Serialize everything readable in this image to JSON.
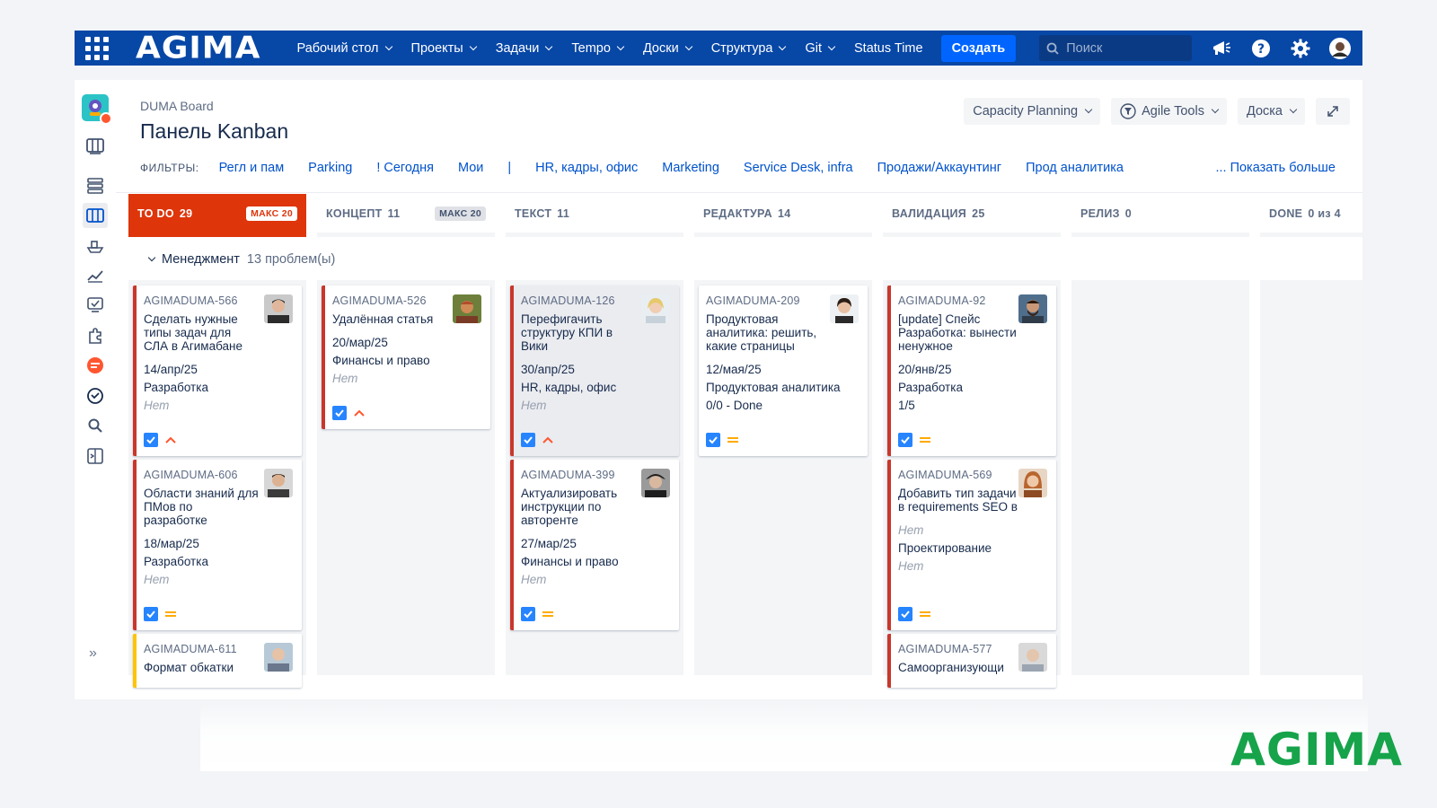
{
  "topbar": {
    "logo": "AGIMA",
    "nav": [
      "Рабочий стол",
      "Проекты",
      "Задачи",
      "Tempo",
      "Доски",
      "Структура",
      "Git"
    ],
    "status_time": "Status Time",
    "create_label": "Создать",
    "search_placeholder": "Поиск",
    "accent": "#0747a6"
  },
  "sidebar": {
    "icons": [
      "board-icon",
      "backlog-icon",
      "kanban-icon",
      "releases-icon",
      "reports-icon",
      "pages-icon",
      "addons-icon",
      "timer-app-icon",
      "clock-icon",
      "search-icon",
      "shortcut-icon"
    ],
    "expand": "»"
  },
  "header": {
    "breadcrumb": "DUMA Board",
    "title": "Панель Kanban",
    "buttons": [
      "Capacity Planning",
      "Agile Tools",
      "Доска"
    ]
  },
  "filters": {
    "label": "ФИЛЬТРЫ:",
    "items": [
      "Регл и пам",
      "Parking",
      "! Сегодня",
      "Мои",
      "|",
      "HR, кадры, офис",
      "Marketing",
      "Service Desk, infra",
      "Продажи/Аккаунтинг",
      "Прод аналитика"
    ],
    "show_more": "... Показать больше"
  },
  "columns": [
    {
      "name": "TO DO",
      "count": "29",
      "max": "МАКС 20",
      "over_limit": true
    },
    {
      "name": "КОНЦЕПТ",
      "count": "11",
      "max": "МАКС 20",
      "over_limit": false
    },
    {
      "name": "ТЕКСТ",
      "count": "11",
      "max": "",
      "over_limit": false
    },
    {
      "name": "РЕДАКТУРА",
      "count": "14",
      "max": "",
      "over_limit": false
    },
    {
      "name": "ВАЛИДАЦИЯ",
      "count": "25",
      "max": "",
      "over_limit": false
    },
    {
      "name": "РЕЛИЗ",
      "count": "0",
      "max": "",
      "over_limit": false
    },
    {
      "name": "DONE",
      "count": "0 из 4",
      "max": "",
      "over_limit": false
    }
  ],
  "swimlane": {
    "name": "Менеджмент",
    "count": "13 проблем(ы)"
  },
  "cards": [
    {
      "key": "AGIMADUMA-566",
      "summary": "Сделать нужные типы задач для СЛА в Агимабане",
      "date": "14/апр/25",
      "field1": "Разработка",
      "field2": "Нет",
      "priority": "high"
    },
    {
      "key": "AGIMADUMA-606",
      "summary": "Области знаний для ПМов по разработке",
      "date": "18/мар/25",
      "field1": "Разработка",
      "field2": "Нет",
      "priority": "medium"
    },
    {
      "key": "AGIMADUMA-611",
      "summary": "Формат обкатки",
      "priority": "none"
    },
    {
      "key": "AGIMADUMA-526",
      "summary": "Удалённая статья",
      "date": "20/мар/25",
      "field1": "Финансы и право",
      "field2": "Нет",
      "priority": "high"
    },
    {
      "key": "AGIMADUMA-126",
      "summary": "Перефигачить структуру КПИ в Вики",
      "date": "30/апр/25",
      "field1": "HR, кадры, офис",
      "field2": "Нет",
      "priority": "high"
    },
    {
      "key": "AGIMADUMA-399",
      "summary": "Актуализировать инструкции по авторенте",
      "date": "27/мар/25",
      "field1": "Финансы и право",
      "field2": "Нет",
      "priority": "medium"
    },
    {
      "key": "AGIMADUMA-209",
      "summary": "Продуктовая аналитика: решить, какие страницы",
      "date": "12/мая/25",
      "field1": "Продуктовая аналитика",
      "field2": "0/0 - Done",
      "priority": "medium"
    },
    {
      "key": "AGIMADUMA-92",
      "summary": "[update] Спейс Разработка: вынести ненужное",
      "date": "20/янв/25",
      "field1": "Разработка",
      "field2": "1/5",
      "priority": "medium"
    },
    {
      "key": "AGIMADUMA-569",
      "summary": "Добавить тип задачи в requirements SEO в",
      "date": "Нет",
      "field1": "Проектирование",
      "field2": "Нет",
      "priority": "medium"
    },
    {
      "key": "AGIMADUMA-577",
      "summary": "Самоорганизующи",
      "priority": "none"
    }
  ],
  "brand_corner": "AGIMA",
  "colors": {
    "over_limit": "#de350b",
    "card_stripe": "#c9372c",
    "link": "#0052cc",
    "brand_green": "#16a34a"
  }
}
